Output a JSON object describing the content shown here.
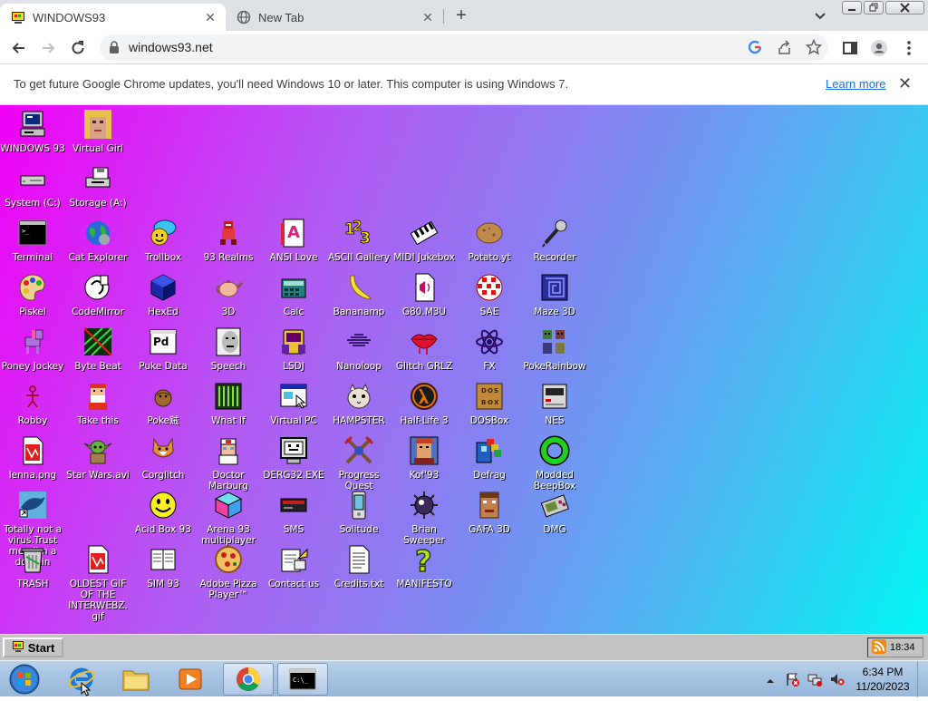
{
  "browser": {
    "tabs": [
      {
        "title": "WINDOWS93",
        "active": true
      },
      {
        "title": "New Tab",
        "active": false
      }
    ],
    "url": "windows93.net",
    "infobar": {
      "message": "To get future Google Chrome updates, you'll need Windows 10 or later. This computer is using Windows 7.",
      "link": "Learn more"
    }
  },
  "desktop": {
    "icons": [
      {
        "label": "WINDOWS 93",
        "icon": "computer-icon"
      },
      {
        "label": "Virtual Girl",
        "icon": "girl-face-icon"
      },
      {
        "label": "System (C:)",
        "icon": "drive-icon"
      },
      {
        "label": "Storage (A:)",
        "icon": "floppy-drive-icon"
      },
      {
        "label": "Terminal",
        "icon": "terminal-icon"
      },
      {
        "label": "Cat Explorer",
        "icon": "globe-cat-icon"
      },
      {
        "label": "Trollbox",
        "icon": "chat-bubble-icon"
      },
      {
        "label": "93 Realms",
        "icon": "knight-icon"
      },
      {
        "label": "ANSI Love",
        "icon": "ansi-letter-icon"
      },
      {
        "label": "ASCII Gallery",
        "icon": "ascii-numbers-icon"
      },
      {
        "label": "MIDI Jukebox",
        "icon": "piano-icon"
      },
      {
        "label": "Potato.yt",
        "icon": "potato-icon"
      },
      {
        "label": "Recorder",
        "icon": "microphone-icon"
      },
      {
        "label": "Piskel",
        "icon": "palette-icon"
      },
      {
        "label": "CodeMirror",
        "icon": "codemirror-icon"
      },
      {
        "label": "HexEd",
        "icon": "cube-icon"
      },
      {
        "label": "3D",
        "icon": "teapot-icon"
      },
      {
        "label": "Calc",
        "icon": "calculator-icon"
      },
      {
        "label": "Bananamp",
        "icon": "banana-icon"
      },
      {
        "label": "G80.M3U",
        "icon": "audio-file-icon"
      },
      {
        "label": "SAE",
        "icon": "amiga-ball-icon"
      },
      {
        "label": "Maze 3D",
        "icon": "maze-icon"
      },
      {
        "label": "Poney Jockey",
        "icon": "pony-icon"
      },
      {
        "label": "Byte Beat",
        "icon": "bytebeat-icon"
      },
      {
        "label": "Puke Data",
        "icon": "puke-data-icon"
      },
      {
        "label": "Speech",
        "icon": "face-speech-icon"
      },
      {
        "label": "LSDJ",
        "icon": "lsdj-icon"
      },
      {
        "label": "Nanoloop",
        "icon": "waveform-icon"
      },
      {
        "label": "Glitch GRLZ",
        "icon": "lips-icon"
      },
      {
        "label": "FX",
        "icon": "atom-icon"
      },
      {
        "label": "PokeRainbow",
        "icon": "pixel-characters-icon"
      },
      {
        "label": "Robby",
        "icon": "stick-figure-icon"
      },
      {
        "label": "Take this",
        "icon": "bearded-man-icon"
      },
      {
        "label": "Poke贼",
        "icon": "ball-icon"
      },
      {
        "label": "What If",
        "icon": "film-icon"
      },
      {
        "label": "Virtual PC",
        "icon": "window-cursor-icon"
      },
      {
        "label": "HAMPSTER",
        "icon": "hamster-icon"
      },
      {
        "label": "Half-Life 3",
        "icon": "half-life-icon"
      },
      {
        "label": "DOSBox",
        "icon": "dosbox-icon"
      },
      {
        "label": "NES",
        "icon": "nes-console-icon"
      },
      {
        "label": "lenna.png",
        "icon": "image-file-icon"
      },
      {
        "label": "Star Wars.avi",
        "icon": "yoda-icon"
      },
      {
        "label": "Corglitch",
        "icon": "corgi-icon"
      },
      {
        "label": "Doctor Marburg",
        "icon": "doctor-icon"
      },
      {
        "label": "DERG32.EXE",
        "icon": "monitor-face-icon"
      },
      {
        "label": "Progress Quest",
        "icon": "swords-icon"
      },
      {
        "label": "Kof'93",
        "icon": "fighter-icon"
      },
      {
        "label": "Defrag",
        "icon": "defrag-icon"
      },
      {
        "label": "Modded BeepBox",
        "icon": "ring-icon"
      },
      {
        "label": "Totally not a virus.Trust me...I'm a dolphin",
        "icon": "dolphin-icon"
      },
      {
        "label": "Acid Box 93",
        "icon": "smiley-icon"
      },
      {
        "label": "Arena 93 multiplayer",
        "icon": "isometric-cube-icon"
      },
      {
        "label": "SMS",
        "icon": "sms-console-icon"
      },
      {
        "label": "Solitude",
        "icon": "phone-icon"
      },
      {
        "label": "Brian Sweeper",
        "icon": "mine-icon"
      },
      {
        "label": "GAFA 3D",
        "icon": "doom-face-icon"
      },
      {
        "label": "DMG",
        "icon": "gameboy-icon"
      },
      {
        "label": "TRASH",
        "icon": "trash-icon"
      },
      {
        "label": "OLDEST GIF OF THE INTERWEBZ.gif",
        "icon": "gif-file-icon"
      },
      {
        "label": "SIM 93",
        "icon": "book-icon"
      },
      {
        "label": "Adobe Pizza Player™",
        "icon": "pizza-icon"
      },
      {
        "label": "Contact us",
        "icon": "contact-icon"
      },
      {
        "label": "Credits.txt",
        "icon": "text-file-icon"
      },
      {
        "label": "MANIFESTO",
        "icon": "question-mark-icon"
      }
    ]
  },
  "w93_taskbar": {
    "start_label": "Start",
    "time": "18:34"
  },
  "win7_taskbar": {
    "time": "6:34 PM",
    "date": "11/20/2023"
  }
}
